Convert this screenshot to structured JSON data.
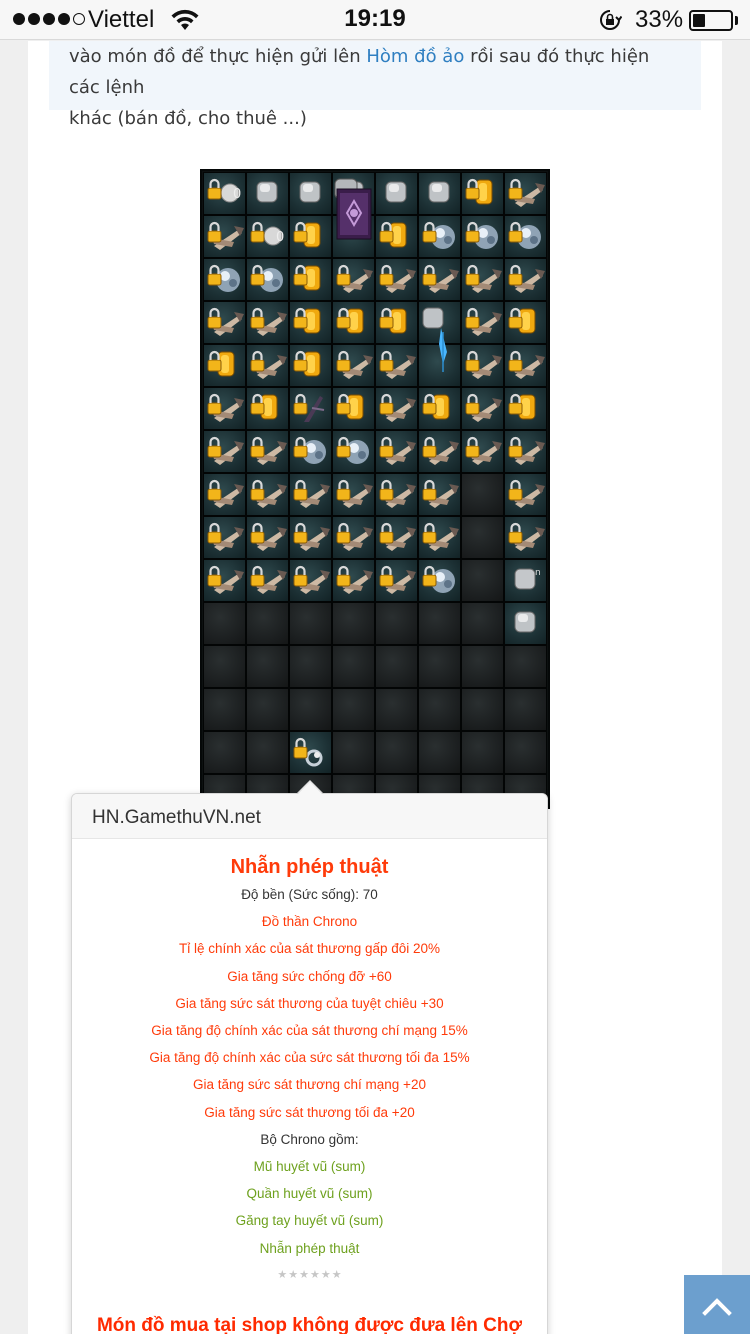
{
  "status_bar": {
    "carrier": "Viettel",
    "time": "19:19",
    "battery_percent": "33%",
    "battery_level": 0.33,
    "signal_bars": 4,
    "signal_bars_total": 5
  },
  "article": {
    "note_line1_before": "vào món đồ để thực hiện gửi lên ",
    "note_link": "Hòm đồ ảo",
    "note_line1_after": " rồi sau đó thực hiện các lệnh",
    "note_line2": "khác (bán đồ, cho thuê ...)"
  },
  "inventory": {
    "cols": 8,
    "rows": [
      [
        "coin-lock",
        "silver-box",
        "silver-box",
        "silver-box",
        "silver-box",
        "silver-box",
        "gold-lock",
        "arrow-lock"
      ],
      [
        "arrow-lock",
        "coin-lock",
        "gold-lock",
        "big",
        "gold-lock",
        "gem-lock",
        "gem-lock",
        "gem-lock"
      ],
      [
        "gem-lock",
        "gem-lock",
        "gold-lock",
        "arrow-lock",
        "arrow-lock",
        "arrow-lock",
        "arrow-lock",
        "arrow-lock"
      ],
      [
        "arrow-lock",
        "arrow-lock",
        "gold-lock",
        "gold-lock",
        "gold-lock",
        "feather",
        "arrow-lock",
        "gold-lock"
      ],
      [
        "gold-lock",
        "arrow-lock",
        "gold-lock",
        "arrow-lock",
        "arrow-lock",
        "feather-cont",
        "arrow-lock",
        "arrow-lock"
      ],
      [
        "arrow-lock",
        "gold-lock",
        "shadow-lock",
        "gold-lock",
        "arrow-lock",
        "gold-lock",
        "arrow-lock",
        "gold-lock"
      ],
      [
        "arrow-lock",
        "arrow-lock",
        "gem-lock",
        "gem-lock",
        "arrow-lock",
        "arrow-lock",
        "arrow-lock",
        "arrow-lock"
      ],
      [
        "arrow-lock",
        "arrow-lock",
        "arrow-lock",
        "arrow-lock",
        "arrow-lock",
        "arrow-lock",
        "empty",
        "arrow-lock"
      ],
      [
        "arrow-lock",
        "arrow-lock",
        "arrow-lock",
        "arrow-lock",
        "arrow-lock",
        "arrow-lock",
        "empty",
        "arrow-lock"
      ],
      [
        "arrow-lock",
        "arrow-lock",
        "arrow-lock",
        "arrow-lock",
        "arrow-lock",
        "gem-lock",
        "empty",
        "silver-ring"
      ],
      [
        "empty",
        "empty",
        "empty",
        "empty",
        "empty",
        "empty",
        "empty",
        "silver-box"
      ],
      [
        "empty",
        "empty",
        "empty",
        "empty",
        "empty",
        "empty",
        "empty",
        "empty"
      ],
      [
        "empty",
        "empty",
        "empty",
        "empty",
        "empty",
        "empty",
        "empty",
        "empty"
      ],
      [
        "empty",
        "empty",
        "ring-lock",
        "empty",
        "empty",
        "empty",
        "empty",
        "empty"
      ],
      [
        "empty",
        "empty",
        "empty",
        "empty",
        "empty",
        "empty",
        "empty",
        "empty"
      ]
    ]
  },
  "tooltip": {
    "site": "HN.GamethuVN.net",
    "item_name": "Nhẫn phép thuật",
    "lines": [
      {
        "text": "Độ bền (Sức sống): 70",
        "color": "dark"
      },
      {
        "text": "Đồ thần Chrono",
        "color": "red"
      },
      {
        "text": "Tỉ lệ chính xác của sát thương gấp đôi 20%",
        "color": "red"
      },
      {
        "text": "Gia tăng sức chống đỡ +60",
        "color": "red"
      },
      {
        "text": "Gia tăng sức sát thương của tuyệt chiêu +30",
        "color": "red"
      },
      {
        "text": "Gia tăng độ chính xác của sát thương chí mạng 15%",
        "color": "red"
      },
      {
        "text": "Gia tăng độ chính xác của sức sát thương tối đa 15%",
        "color": "red"
      },
      {
        "text": "Gia tăng sức sát thương chí mạng +20",
        "color": "red"
      },
      {
        "text": "Gia tăng sức sát thương tối đa +20",
        "color": "red"
      },
      {
        "text": "Bộ Chrono gồm:",
        "color": "dark"
      },
      {
        "text": "Mũ huyết vũ (sum)",
        "color": "green"
      },
      {
        "text": "Quần huyết vũ (sum)",
        "color": "green"
      },
      {
        "text": "Găng tay huyết vũ (sum)",
        "color": "green"
      },
      {
        "text": "Nhẫn phép thuật",
        "color": "green"
      }
    ],
    "stars_total": 6,
    "stars_filled": 0,
    "footer": "Món đồ mua tại shop không được đưa lên Chợ"
  },
  "colors": {
    "accent_red": "#ff3b0a",
    "set_green": "#6ea11e",
    "link_blue": "#2f7fc1",
    "scroll_button": "#6c9fce"
  },
  "icons": {
    "scroll_top": "chevron-up-icon",
    "wifi": "wifi-icon",
    "rotation_lock": "rotation-lock-icon",
    "battery": "battery-icon"
  }
}
